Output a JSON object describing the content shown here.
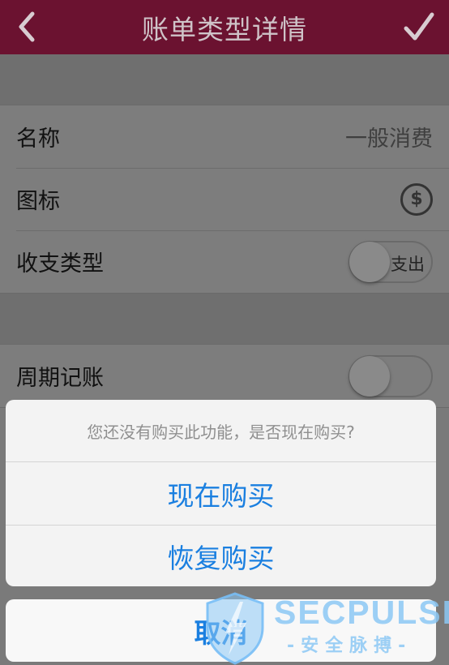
{
  "navbar": {
    "title": "账单类型详情",
    "back_icon": "chevron-left-icon",
    "confirm_icon": "checkmark-icon",
    "background": "#6b1230"
  },
  "fields": {
    "name_label": "名称",
    "name_value": "一般消费",
    "icon_label": "图标",
    "icon_symbol": "$",
    "type_label": "收支类型",
    "type_value": "支出",
    "recurring_label": "周期记账"
  },
  "action_sheet": {
    "message": "您还没有购买此功能，是否现在购买?",
    "buy_now": "现在购买",
    "restore": "恢复购买",
    "cancel": "取消",
    "button_color": "#1a7fe0"
  },
  "watermark": {
    "text": "SECPULSE",
    "subtext": "-安全脉搏-"
  }
}
